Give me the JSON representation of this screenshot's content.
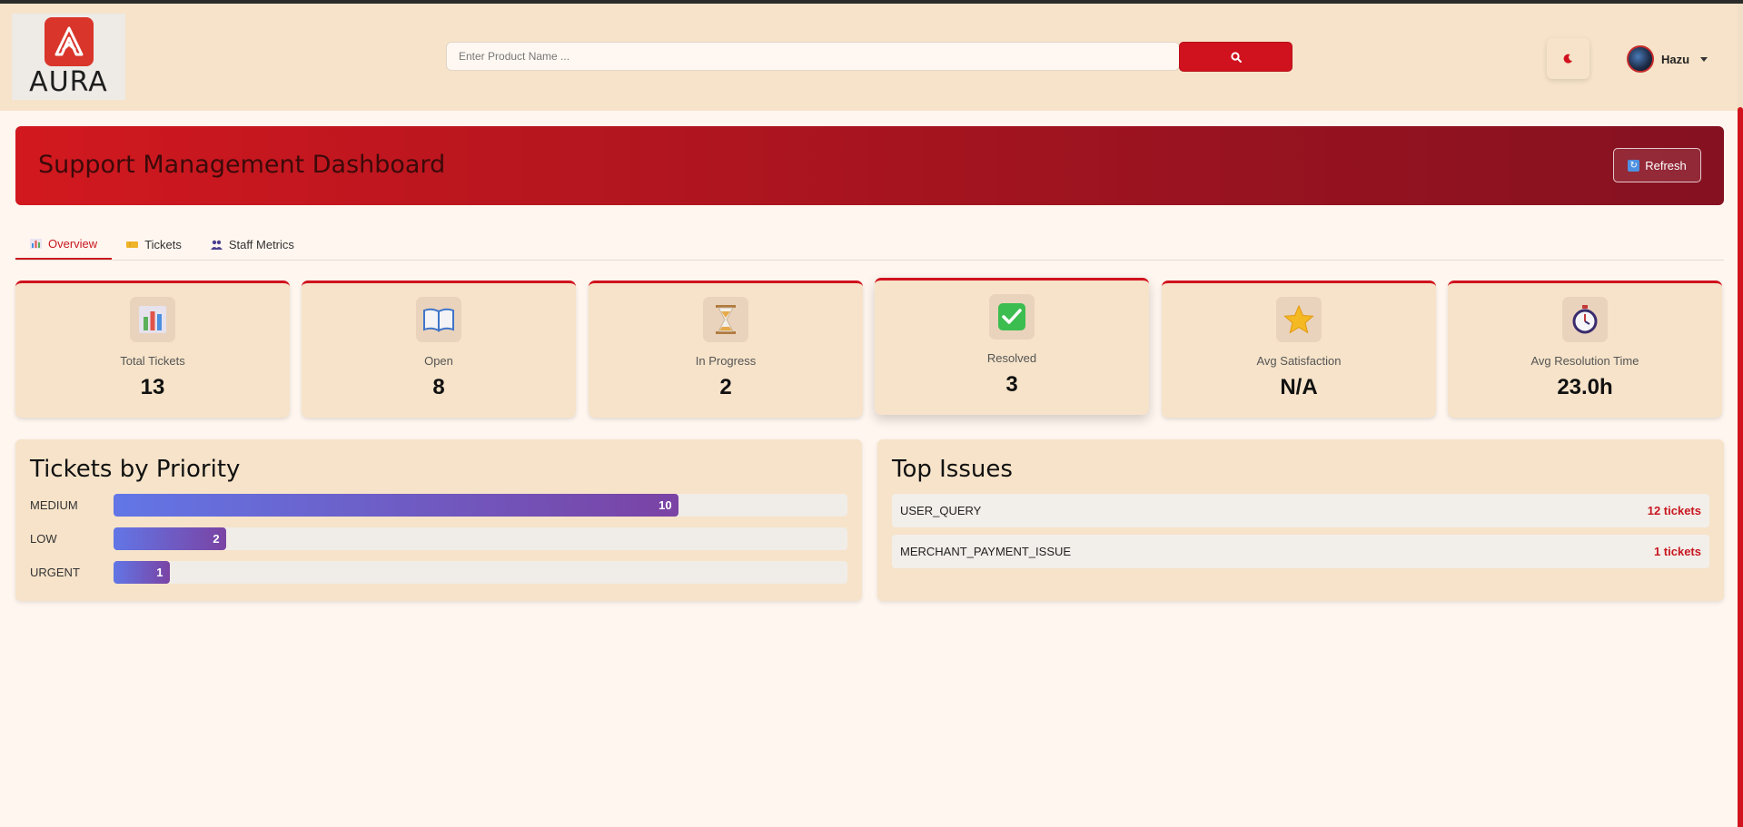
{
  "header": {
    "logo_text": "AURA",
    "search_placeholder": "Enter Product Name ...",
    "user_name": "Hazu"
  },
  "banner": {
    "title": "Support Management Dashboard",
    "refresh_label": "Refresh"
  },
  "tabs": [
    {
      "label": "Overview",
      "icon": "chart-icon",
      "active": true
    },
    {
      "label": "Tickets",
      "icon": "ticket-icon",
      "active": false
    },
    {
      "label": "Staff Metrics",
      "icon": "people-icon",
      "active": false
    }
  ],
  "stats": [
    {
      "label": "Total Tickets",
      "value": "13",
      "icon": "bar-chart-icon"
    },
    {
      "label": "Open",
      "value": "8",
      "icon": "open-book-icon"
    },
    {
      "label": "In Progress",
      "value": "2",
      "icon": "hourglass-icon"
    },
    {
      "label": "Resolved",
      "value": "3",
      "icon": "check-icon"
    },
    {
      "label": "Avg Satisfaction",
      "value": "N/A",
      "icon": "star-icon"
    },
    {
      "label": "Avg Resolution Time",
      "value": "23.0h",
      "icon": "stopwatch-icon"
    }
  ],
  "priority_panel": {
    "title": "Tickets by Priority",
    "rows": [
      {
        "label": "MEDIUM",
        "value": "10",
        "fraction": 0.77
      },
      {
        "label": "LOW",
        "value": "2",
        "fraction": 0.154
      },
      {
        "label": "URGENT",
        "value": "1",
        "fraction": 0.077
      }
    ]
  },
  "issues_panel": {
    "title": "Top Issues",
    "rows": [
      {
        "name": "USER_QUERY",
        "count": "12 tickets"
      },
      {
        "name": "MERCHANT_PAYMENT_ISSUE",
        "count": "1 tickets"
      }
    ]
  },
  "colors": {
    "accent": "#d0121e",
    "header_bg": "#f6e3c9",
    "bar_start": "#6276e6",
    "bar_end": "#7a43a4"
  }
}
